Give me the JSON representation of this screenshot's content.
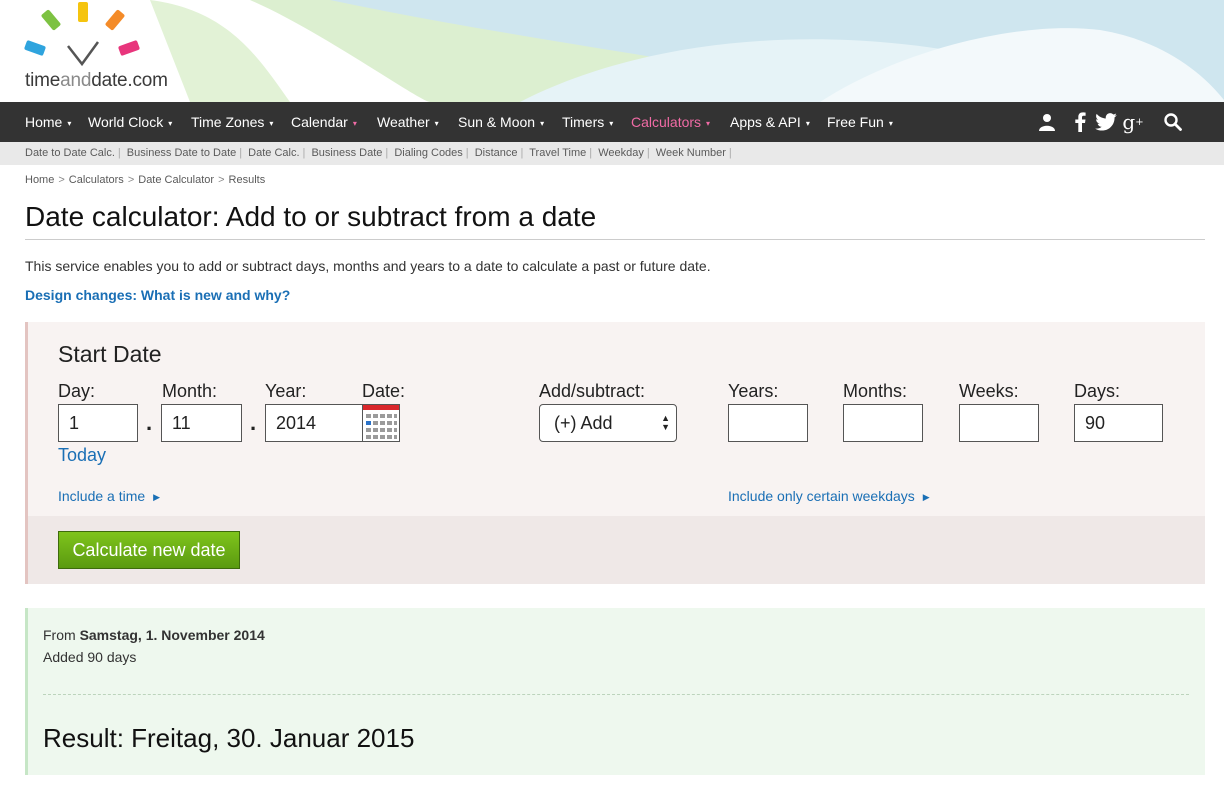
{
  "logo": {
    "time": "time",
    "and": "and",
    "date": "date.com"
  },
  "nav": {
    "items": [
      {
        "label": "Home"
      },
      {
        "label": "World Clock"
      },
      {
        "label": "Time Zones"
      },
      {
        "label": "Calendar"
      },
      {
        "label": "Weather"
      },
      {
        "label": "Sun & Moon"
      },
      {
        "label": "Timers"
      },
      {
        "label": "Calculators"
      },
      {
        "label": "Apps & API"
      },
      {
        "label": "Free Fun"
      }
    ],
    "caret": "▾",
    "active_color": "#f06ba5",
    "icons": [
      "user-icon",
      "facebook-icon",
      "twitter-icon",
      "google-plus-icon",
      "search-icon"
    ]
  },
  "subnav": {
    "items": [
      "Date to Date Calc.",
      "Business Date to Date",
      "Date Calc.",
      "Business Date",
      "Dialing Codes",
      "Distance",
      "Travel Time",
      "Weekday",
      "Week Number"
    ]
  },
  "breadcrumb": [
    "Home",
    "Calculators",
    "Date Calculator",
    "Results"
  ],
  "page": {
    "title": "Date calculator: Add to or subtract from a date",
    "intro": "This service enables you to add or subtract days, months and years to a date to calculate a past or future date.",
    "design_link": "Design changes: What is new and why?"
  },
  "form": {
    "section_title": "Start Date",
    "day_label": "Day:",
    "month_label": "Month:",
    "year_label": "Year:",
    "date_label": "Date:",
    "day_value": "1",
    "month_value": "11",
    "year_value": "2014",
    "separator": ".",
    "today_link": "Today",
    "add_subtract_label": "Add/subtract:",
    "add_subtract_value": "(+) Add",
    "years_label": "Years:",
    "months_label": "Months:",
    "weeks_label": "Weeks:",
    "days_label": "Days:",
    "years_value": "",
    "months_value": "",
    "weeks_value": "",
    "days_value": "90",
    "include_time": "Include a time",
    "include_weekdays": "Include only certain weekdays",
    "calculate_button": "Calculate new date",
    "button_color": "#6cb01a"
  },
  "result": {
    "from_prefix": "From",
    "from_date": "Samstag, 1. November 2014",
    "added": "Added 90 days",
    "result_text": "Result: Freitag, 30. Januar 2015"
  }
}
